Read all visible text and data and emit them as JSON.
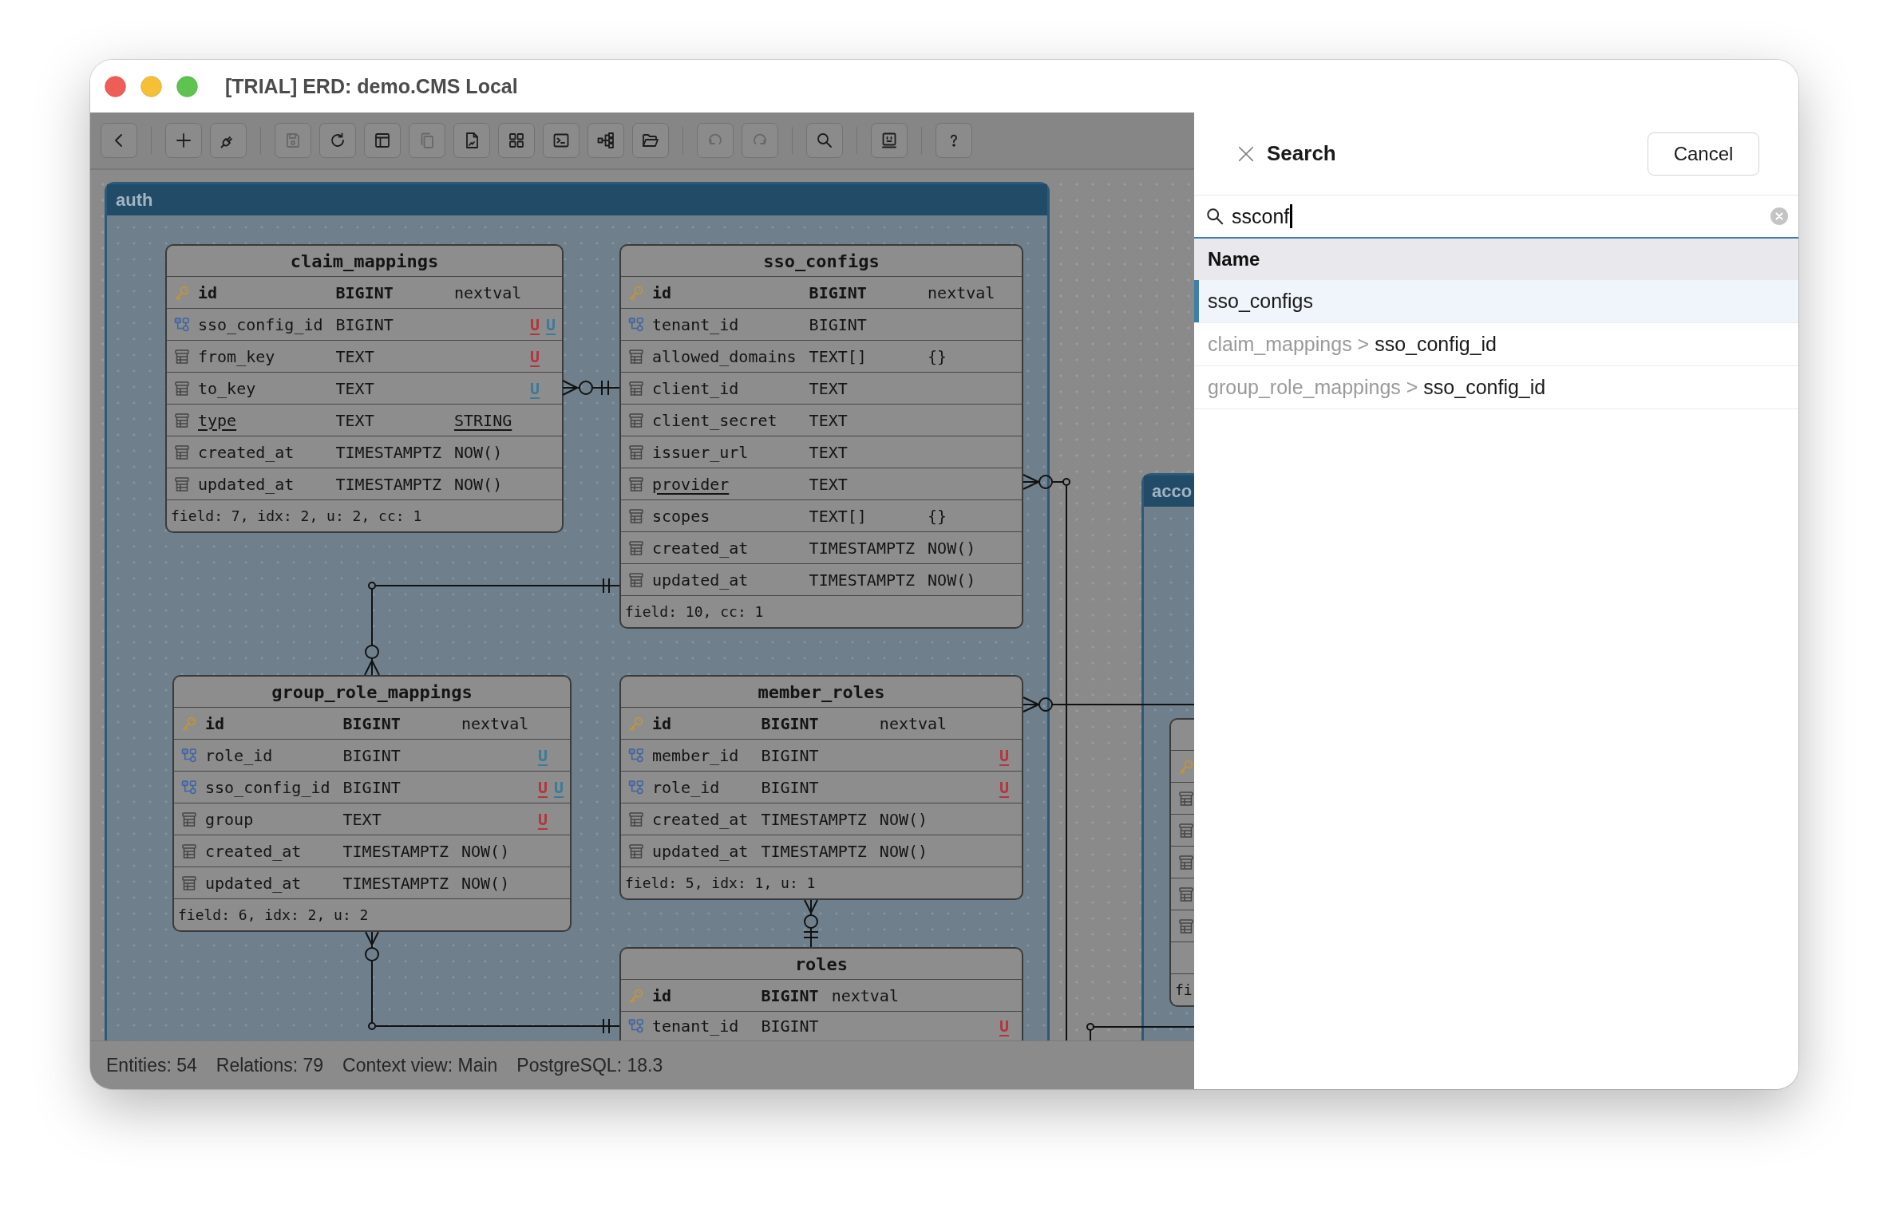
{
  "window": {
    "title": "[TRIAL] ERD: demo.CMS Local"
  },
  "toolbar": [
    [
      {
        "disabled": false
      }
    ],
    [
      {
        "disabled": false
      },
      {
        "disabled": false
      }
    ],
    [
      {
        "disabled": true
      },
      {
        "disabled": false
      },
      {
        "disabled": false
      },
      {
        "disabled": true
      },
      {
        "disabled": false
      },
      {
        "disabled": false
      },
      {
        "disabled": false
      },
      {
        "disabled": false
      },
      {
        "disabled": false
      }
    ],
    [
      {
        "disabled": true
      },
      {
        "disabled": true
      }
    ],
    [
      {
        "disabled": false
      }
    ],
    [
      {
        "disabled": false
      }
    ],
    [
      {
        "disabled": false
      }
    ]
  ],
  "diagram": {
    "groups": [
      {
        "name": "auth",
        "entities": [
          {
            "name": "claim_mappings",
            "fields": [
              {
                "kind": "pk",
                "name": "id",
                "type": "BIGINT",
                "default": "nextval",
                "underlined": false
              },
              {
                "kind": "fk",
                "name": "sso_config_id",
                "type": "BIGINT",
                "underlined": false,
                "flags": [
                  {
                    "label": "U",
                    "color": "#b3363c"
                  },
                  {
                    "label": "U",
                    "color": "#3c7a9a"
                  }
                ]
              },
              {
                "kind": "column",
                "name": "from_key",
                "type": "TEXT",
                "underlined": false,
                "flags": [
                  {
                    "label": "U",
                    "color": "#b3363c"
                  }
                ]
              },
              {
                "kind": "column",
                "name": "to_key",
                "type": "TEXT",
                "underlined": false,
                "flags": [
                  {
                    "label": "U",
                    "color": "#3c7a9a"
                  }
                ]
              },
              {
                "kind": "column",
                "name": "type",
                "type": "TEXT",
                "default": "STRING",
                "underlined": true
              },
              {
                "kind": "column",
                "name": "created_at",
                "type": "TIMESTAMPTZ",
                "default": "NOW()",
                "underlined": false
              },
              {
                "kind": "column",
                "name": "updated_at",
                "type": "TIMESTAMPTZ",
                "default": "NOW()",
                "underlined": false
              }
            ],
            "footer": "field: 7, idx: 2, u: 2, cc: 1"
          },
          {
            "name": "sso_configs",
            "fields": [
              {
                "kind": "pk",
                "name": "id",
                "type": "BIGINT",
                "default": "nextval",
                "underlined": false
              },
              {
                "kind": "fk",
                "name": "tenant_id",
                "type": "BIGINT",
                "underlined": false
              },
              {
                "kind": "column",
                "name": "allowed_domains",
                "type": "TEXT[]",
                "default": "{}",
                "underlined": false
              },
              {
                "kind": "column",
                "name": "client_id",
                "type": "TEXT",
                "underlined": false
              },
              {
                "kind": "column",
                "name": "client_secret",
                "type": "TEXT",
                "underlined": false
              },
              {
                "kind": "column",
                "name": "issuer_url",
                "type": "TEXT",
                "underlined": false
              },
              {
                "kind": "column",
                "name": "provider",
                "type": "TEXT",
                "underlined": true
              },
              {
                "kind": "column",
                "name": "scopes",
                "type": "TEXT[]",
                "default": "{}",
                "underlined": false
              },
              {
                "kind": "column",
                "name": "created_at",
                "type": "TIMESTAMPTZ",
                "default": "NOW()",
                "underlined": false
              },
              {
                "kind": "column",
                "name": "updated_at",
                "type": "TIMESTAMPTZ",
                "default": "NOW()",
                "underlined": false
              }
            ],
            "footer": "field: 10, cc: 1"
          },
          {
            "name": "group_role_mappings",
            "fields": [
              {
                "kind": "pk",
                "name": "id",
                "type": "BIGINT",
                "default": "nextval",
                "underlined": false
              },
              {
                "kind": "fk",
                "name": "role_id",
                "type": "BIGINT",
                "underlined": false,
                "flags": [
                  {
                    "label": "U",
                    "color": "#3c7a9a"
                  }
                ]
              },
              {
                "kind": "fk",
                "name": "sso_config_id",
                "type": "BIGINT",
                "underlined": false,
                "flags": [
                  {
                    "label": "U",
                    "color": "#b3363c"
                  },
                  {
                    "label": "U",
                    "color": "#3c7a9a"
                  }
                ]
              },
              {
                "kind": "column",
                "name": "group",
                "type": "TEXT",
                "underlined": false,
                "flags": [
                  {
                    "label": "U",
                    "color": "#b3363c"
                  }
                ]
              },
              {
                "kind": "column",
                "name": "created_at",
                "type": "TIMESTAMPTZ",
                "default": "NOW()",
                "underlined": false
              },
              {
                "kind": "column",
                "name": "updated_at",
                "type": "TIMESTAMPTZ",
                "default": "NOW()",
                "underlined": false
              }
            ],
            "footer": "field: 6, idx: 2, u: 2"
          },
          {
            "name": "member_roles",
            "fields": [
              {
                "kind": "pk",
                "name": "id",
                "type": "BIGINT",
                "default": "nextval",
                "underlined": false
              },
              {
                "kind": "fk",
                "name": "member_id",
                "type": "BIGINT",
                "underlined": false,
                "flags": [
                  {
                    "label": "U",
                    "color": "#b3363c"
                  }
                ]
              },
              {
                "kind": "fk",
                "name": "role_id",
                "type": "BIGINT",
                "underlined": false,
                "flags": [
                  {
                    "label": "U",
                    "color": "#b3363c"
                  }
                ]
              },
              {
                "kind": "column",
                "name": "created_at",
                "type": "TIMESTAMPTZ",
                "default": "NOW()",
                "underlined": false
              },
              {
                "kind": "column",
                "name": "updated_at",
                "type": "TIMESTAMPTZ",
                "default": "NOW()",
                "underlined": false
              }
            ],
            "footer": "field: 5, idx: 1, u: 1"
          },
          {
            "name": "roles",
            "fields": [
              {
                "kind": "pk",
                "name": "id",
                "type": "BIGINT",
                "default": "nextval",
                "underlined": false
              },
              {
                "kind": "fk",
                "name": "tenant_id",
                "type": "BIGINT",
                "underlined": false,
                "flags": [
                  {
                    "label": "U",
                    "color": "#b3363c"
                  }
                ]
              }
            ]
          }
        ]
      },
      {
        "name": "acco",
        "entities": [
          {
            "fields": [
              {
                "kind": "pk"
              },
              {
                "kind": "column"
              },
              {
                "kind": "column"
              },
              {
                "kind": "column"
              },
              {
                "kind": "column"
              },
              {
                "kind": "column"
              },
              {
                "kind": "empty"
              }
            ],
            "footer": "fi"
          }
        ]
      }
    ]
  },
  "status_bar": [
    "Entities: 54",
    "Relations: 79",
    "Context view: Main",
    "PostgreSQL: 18.3"
  ],
  "search_panel": {
    "title": "Search",
    "cancel": "Cancel",
    "field": {
      "value": "ssconf",
      "focused": true
    },
    "column": "Name",
    "results": [
      {
        "name": "sso_configs",
        "selected": true
      },
      {
        "path": "claim_mappings >",
        "name": "sso_config_id",
        "selected": false
      },
      {
        "path": "group_role_mappings >",
        "name": "sso_config_id",
        "selected": false
      }
    ]
  }
}
